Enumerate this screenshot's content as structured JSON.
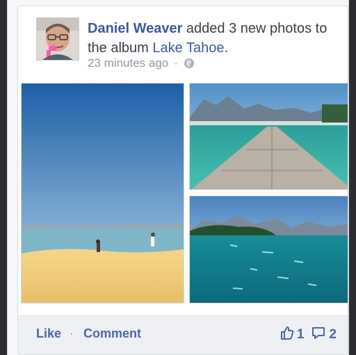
{
  "post": {
    "actor": "Daniel Weaver",
    "action_text": " added 3 new photos to the album ",
    "album": "Lake Tahoe",
    "album_suffix": ".",
    "timestamp": "23 minutes ago",
    "separator": "·",
    "privacy_icon": "globe-icon"
  },
  "photos": [
    {
      "name": "beach-photo"
    },
    {
      "name": "pier-photo"
    },
    {
      "name": "lake-photo"
    }
  ],
  "actions": {
    "like": "Like",
    "separator": "·",
    "comment": "Comment"
  },
  "stats": {
    "likes": "1",
    "comments": "2",
    "like_icon": "thumbs-up-icon",
    "comment_icon": "comment-bubble-icon"
  },
  "colors": {
    "brand_blue": "#3b5998",
    "action_blue": "#4b67a1",
    "muted_gray": "#9197a3"
  }
}
